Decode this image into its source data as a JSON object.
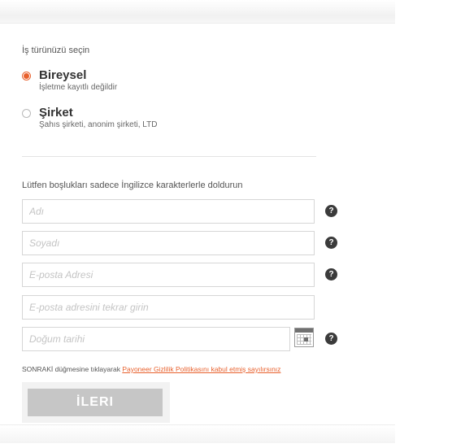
{
  "business_type": {
    "label": "İş türünüzü seçin",
    "options": [
      {
        "title": "Bireysel",
        "subtitle": "İşletme kayıtlı değildir",
        "selected": true
      },
      {
        "title": "Şirket",
        "subtitle": "Şahıs şirketi, anonim şirketi, LTD",
        "selected": false
      }
    ]
  },
  "form": {
    "instruction": "Lütfen boşlukları sadece İngilizce karakterlerle doldurun",
    "fields": {
      "first_name": {
        "placeholder": "Adı",
        "value": ""
      },
      "last_name": {
        "placeholder": "Soyadı",
        "value": ""
      },
      "email": {
        "placeholder": "E-posta Adresi",
        "value": ""
      },
      "email_confirm": {
        "placeholder": "E-posta adresini tekrar girin",
        "value": ""
      },
      "birth_date": {
        "placeholder": "Doğum tarihi",
        "value": ""
      }
    },
    "help_glyph": "?"
  },
  "consent": {
    "prefix": "SONRAKİ düğmesine tıklayarak ",
    "link_text": "Payoneer Gizlilik Politikasını kabul etmiş sayılırsınız"
  },
  "next_button": {
    "label": "İLERI"
  },
  "colors": {
    "accent": "#e8602c",
    "button_disabled": "#c6c6c6",
    "help_icon": "#3b3b3b"
  }
}
